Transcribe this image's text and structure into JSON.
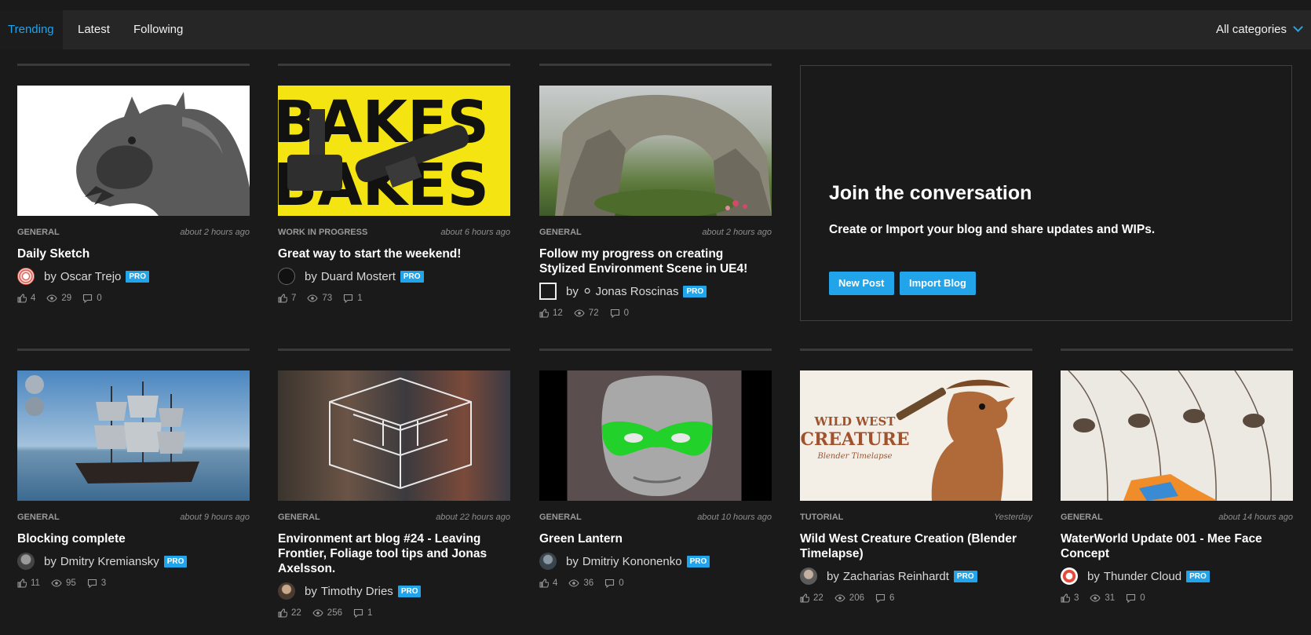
{
  "tabs": [
    {
      "label": "Trending",
      "active": true
    },
    {
      "label": "Latest",
      "active": false
    },
    {
      "label": "Following",
      "active": false
    }
  ],
  "category_filter": {
    "selected": "All categories"
  },
  "author_prefix": "by",
  "pro_badge": "PRO",
  "posts": [
    {
      "category": "GENERAL",
      "time": "about 2 hours ago",
      "title": "Daily Sketch",
      "author": "Oscar Trejo",
      "pro": true,
      "likes": "4",
      "views": "29",
      "comments": "0"
    },
    {
      "category": "WORK IN PROGRESS",
      "time": "about 6 hours ago",
      "title": "Great way to start the weekend!",
      "author": "Duard Mostert",
      "pro": true,
      "likes": "7",
      "views": "73",
      "comments": "1",
      "thumb_text": [
        "BAKES",
        "BAKES"
      ]
    },
    {
      "category": "GENERAL",
      "time": "about 2 hours ago",
      "title": "Follow my progress on creating Stylized Environment Scene in UE4!",
      "author": "⚪ Jonas Roscinas",
      "pro": true,
      "likes": "12",
      "views": "72",
      "comments": "0"
    },
    {
      "category": "GENERAL",
      "time": "about 9 hours ago",
      "title": "Blocking complete",
      "author": "Dmitry Kremiansky",
      "pro": true,
      "likes": "11",
      "views": "95",
      "comments": "3"
    },
    {
      "category": "GENERAL",
      "time": "about 22 hours ago",
      "title": "Environment art blog #24 - Leaving Frontier, Foliage tool tips and Jonas Axelsson.",
      "author": "Timothy Dries",
      "pro": true,
      "likes": "22",
      "views": "256",
      "comments": "1"
    },
    {
      "category": "GENERAL",
      "time": "about 10 hours ago",
      "title": "Green Lantern",
      "author": "Dmitriy Kononenko",
      "pro": true,
      "likes": "4",
      "views": "36",
      "comments": "0"
    },
    {
      "category": "TUTORIAL",
      "time": "Yesterday",
      "title": "Wild West Creature Creation (Blender Timelapse)",
      "author": "Zacharias Reinhardt",
      "pro": true,
      "likes": "22",
      "views": "206",
      "comments": "6",
      "thumb_text": [
        "WILD WEST",
        "CREATURE",
        "Blender Timelapse"
      ]
    },
    {
      "category": "GENERAL",
      "time": "about 14 hours ago",
      "title": "WaterWorld Update 001 - Mee Face Concept",
      "author": "Thunder Cloud",
      "pro": true,
      "likes": "3",
      "views": "31",
      "comments": "0"
    }
  ],
  "join": {
    "title": "Join the conversation",
    "subtitle": "Create or Import your blog and share updates and WIPs.",
    "new_post_label": "New Post",
    "import_blog_label": "Import Blog"
  },
  "colors": {
    "accent": "#21a4ea",
    "background": "#1a1a1a",
    "bar": "#262626"
  },
  "icons": {
    "like": "thumbs-up-icon",
    "views": "eye-icon",
    "comments": "comment-icon",
    "dropdown": "chevron-down-icon"
  }
}
